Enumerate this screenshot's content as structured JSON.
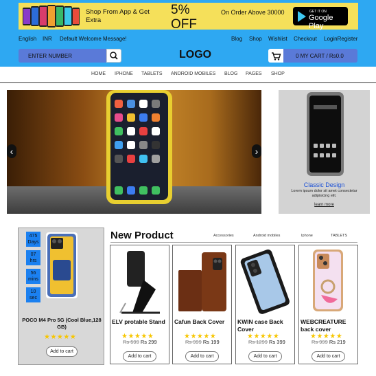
{
  "promo": {
    "app_text": "Shop From App & Get Extra",
    "discount": "5%\nOFF",
    "discount_line1": "5%",
    "discount_line2": "OFF",
    "order_text": "On Order Above 30000",
    "store_small": "GET IT ON",
    "store_big": "Google Play"
  },
  "toplinks": {
    "language": "English",
    "currency": "INR",
    "welcome": "Default Welcome Message!",
    "blog": "Blog",
    "shop": "Shop",
    "wishlist": "Wishlist",
    "checkout": "Checkout",
    "login_register": "LoginRegister"
  },
  "search": {
    "placeholder": "ENTER NUMBER",
    "icon": "search-icon"
  },
  "logo": "LOGO",
  "cart": {
    "label": "0 MY CART / Rs0.0",
    "icon": "cart-icon"
  },
  "nav": [
    "HOME",
    "IPHONE",
    "TABLETS",
    "ANDROID MOBILES",
    "BLOG",
    "PAGES",
    "SHOP"
  ],
  "ad": {
    "title": "Classic Design",
    "description": "Lorem ipsum dolor sit amet consectetur adipisicing elit.",
    "link": "learn more"
  },
  "deal": {
    "timer": [
      {
        "value": "475",
        "unit": "Days"
      },
      {
        "value": "07",
        "unit": "hrs"
      },
      {
        "value": "56",
        "unit": "mins"
      },
      {
        "value": "10",
        "unit": "sec"
      }
    ],
    "name": "POCO M4 Pro 5G (Cool Blue,128 GB)",
    "rating": 5,
    "stars": "★★★★★",
    "button": "Add to cart"
  },
  "new_product": {
    "title": "New Product",
    "tabs": [
      "Accessories",
      "Android mobiles",
      "Iphone",
      "TABLETS"
    ],
    "items": [
      {
        "title": "ELV protable Stand",
        "old_price": "Rs 599",
        "price": "Rs 299",
        "stars": "★★★★★",
        "button": "Add to cart"
      },
      {
        "title": "Cafun Back Cover",
        "old_price": "Rs 999",
        "price": "Rs 199",
        "stars": "★★★★★",
        "button": "Add to cart"
      },
      {
        "title": "KWIN case Back Cover",
        "old_price": "Rs 1299",
        "price": "Rs 399",
        "stars": "★★★★★",
        "button": "Add to cart"
      },
      {
        "title": "WEBCREATURE back cover",
        "old_price": "Rs 999",
        "price": "Rs 219",
        "stars": "★★★★★",
        "button": "Add to cart"
      }
    ]
  },
  "colors": {
    "header_bg": "#2ea8f2",
    "promo_bg": "#f5e05a",
    "accent_blue": "#5a7ad8",
    "timer_blue": "#1b80f0",
    "star": "#f7c600",
    "ad_title": "#1a4fd6"
  }
}
